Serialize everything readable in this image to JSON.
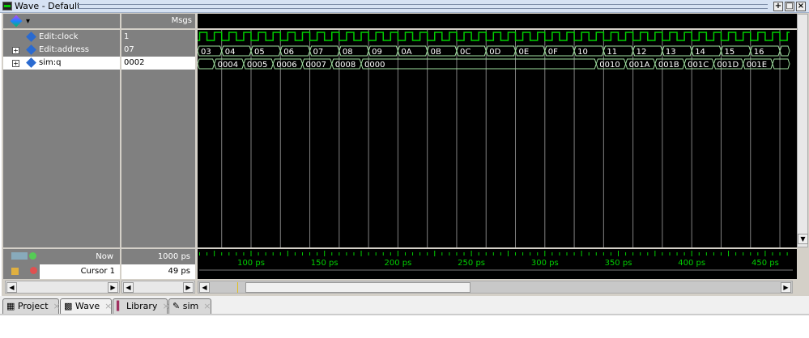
{
  "window": {
    "title": "Wave - Default"
  },
  "header": {
    "msgs_label": "Msgs"
  },
  "signals": [
    {
      "name": "Edit:clock",
      "value": "1",
      "expandable": false
    },
    {
      "name": "Edit:address",
      "value": "07",
      "expandable": true
    },
    {
      "name": "sim:q",
      "value": "0002",
      "expandable": true
    }
  ],
  "cursor_panel": {
    "now_label": "Now",
    "now_value": "1000 ps",
    "cursor_label": "Cursor 1",
    "cursor_value": "49 ps"
  },
  "waves": {
    "view_start_ps": 64,
    "view_end_ps": 466,
    "clock": {
      "period_ps": 10,
      "fall_offset_ps": 0
    },
    "address": {
      "changes": [
        [
          0,
          "03"
        ],
        [
          80,
          "04"
        ],
        [
          100,
          "05"
        ],
        [
          120,
          "06"
        ],
        [
          140,
          "07"
        ],
        [
          160,
          "08"
        ],
        [
          180,
          "09"
        ],
        [
          200,
          "0A"
        ],
        [
          220,
          "0B"
        ],
        [
          240,
          "0C"
        ],
        [
          260,
          "0D"
        ],
        [
          280,
          "0E"
        ],
        [
          300,
          "0F"
        ],
        [
          320,
          "10"
        ],
        [
          340,
          "11"
        ],
        [
          360,
          "12"
        ],
        [
          380,
          "13"
        ],
        [
          400,
          "14"
        ],
        [
          420,
          "15"
        ],
        [
          440,
          "16"
        ],
        [
          460,
          ""
        ]
      ]
    },
    "q": {
      "changes": [
        [
          0,
          ""
        ],
        [
          75,
          "0004"
        ],
        [
          95,
          "0005"
        ],
        [
          115,
          "0006"
        ],
        [
          135,
          "0007"
        ],
        [
          155,
          "0008"
        ],
        [
          175,
          "0000"
        ],
        [
          335,
          "0010"
        ],
        [
          355,
          "001A"
        ],
        [
          375,
          "001B"
        ],
        [
          395,
          "001C"
        ],
        [
          415,
          "001D"
        ],
        [
          435,
          "001E"
        ],
        [
          455,
          ""
        ]
      ]
    },
    "gridlines_ps": [
      80,
      100,
      120,
      140,
      160,
      180,
      200,
      220,
      240,
      260,
      280,
      300,
      320,
      340,
      360,
      380,
      400,
      420,
      440,
      460
    ]
  },
  "timeline": {
    "labels": [
      {
        "t": 100,
        "text": "100 ps"
      },
      {
        "t": 150,
        "text": "150 ps"
      },
      {
        "t": 200,
        "text": "200 ps"
      },
      {
        "t": 250,
        "text": "250 ps"
      },
      {
        "t": 300,
        "text": "300 ps"
      },
      {
        "t": 350,
        "text": "350 ps"
      },
      {
        "t": 400,
        "text": "400 ps"
      },
      {
        "t": 450,
        "text": "450 ps"
      }
    ]
  },
  "tabs": [
    {
      "label": "Project",
      "active": false
    },
    {
      "label": "Wave",
      "active": true
    },
    {
      "label": "Library",
      "active": false
    },
    {
      "label": "sim",
      "active": false
    }
  ],
  "colors": {
    "wave": "#00d000",
    "bus": "#a0e0a0",
    "grid": "#808080",
    "bg": "#000000"
  }
}
